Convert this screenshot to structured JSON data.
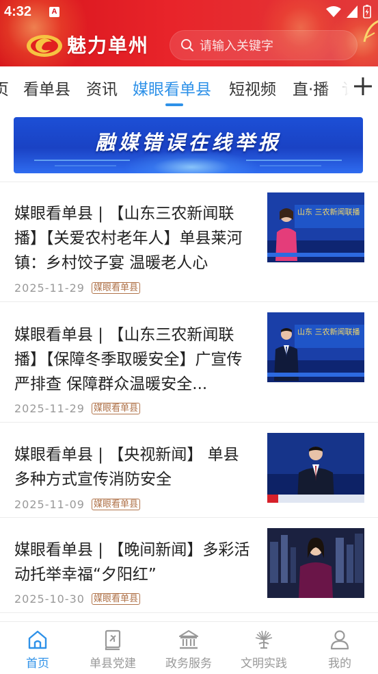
{
  "status_bar": {
    "time": "4:32",
    "app_icon_letter": "A"
  },
  "header": {
    "app_title": "魅力单州",
    "search_placeholder": "请输入关键字",
    "brand_color": "#e1201f"
  },
  "tabs": {
    "items": [
      {
        "label": "页"
      },
      {
        "label": "看单县"
      },
      {
        "label": "资讯"
      },
      {
        "label": "媒眼看单县"
      },
      {
        "label": "短视频"
      },
      {
        "label": "直·播"
      },
      {
        "label": "讠"
      }
    ],
    "active_index": 3,
    "active_color": "#2e91e8"
  },
  "banner": {
    "text": "融媒错误在线举报"
  },
  "news": [
    {
      "title": "媒眼看单县 | 【山东三农新闻联播】【关爱农村老年人】单县莱河镇：乡村饺子宴  温暖老人心",
      "date": "2025-11-29",
      "tag": "媒眼看单县",
      "thumb_caption": "山东 三农新闻联播"
    },
    {
      "title": "媒眼看单县 | 【山东三农新闻联播】【保障冬季取暖安全】广宣传严排查  保障群众温暖安全...",
      "date": "2025-11-29",
      "tag": "媒眼看单县",
      "thumb_caption": "山东 三农新闻联播"
    },
    {
      "title": "媒眼看单县 | 【央视新闻】  单县多种方式宣传消防安全",
      "date": "2025-11-09",
      "tag": "媒眼看单县",
      "thumb_caption": ""
    },
    {
      "title": "媒眼看单县 | 【晚间新闻】多彩活动托举幸福“夕阳红”",
      "date": "2025-10-30",
      "tag": "媒眼看单县",
      "thumb_caption": ""
    }
  ],
  "bottom_nav": {
    "items": [
      {
        "label": "首页",
        "icon": "home-icon"
      },
      {
        "label": "单县党建",
        "icon": "party-book-icon"
      },
      {
        "label": "政务服务",
        "icon": "government-building-icon"
      },
      {
        "label": "文明实践",
        "icon": "civilization-emblem-icon"
      },
      {
        "label": "我的",
        "icon": "profile-icon"
      }
    ],
    "active_index": 0
  }
}
